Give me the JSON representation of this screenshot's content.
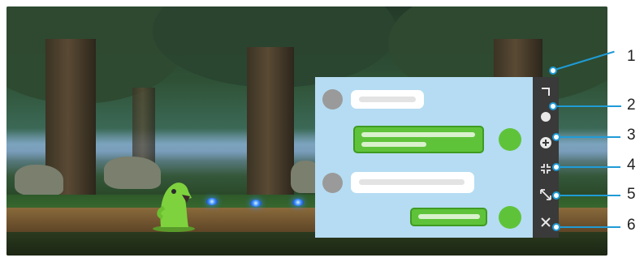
{
  "sidebar": {
    "items": [
      {
        "id": "1",
        "icon": "corner-icon",
        "glyph": "⌐"
      },
      {
        "id": "2",
        "icon": "circle-icon",
        "glyph": "●"
      },
      {
        "id": "3",
        "icon": "add-icon",
        "glyph": "⊕"
      },
      {
        "id": "4",
        "icon": "minimize-icon",
        "glyph": "⤡"
      },
      {
        "id": "5",
        "icon": "resize-icon",
        "glyph": "⤢"
      },
      {
        "id": "6",
        "icon": "close-icon",
        "glyph": "×"
      }
    ]
  },
  "callouts": [
    "1",
    "2",
    "3",
    "4",
    "5",
    "6"
  ],
  "colors": {
    "panel": "#b5dcf2",
    "sidebar": "#3a3a3a",
    "accent_green": "#5fc33a",
    "callout": "#1f9bd6"
  }
}
